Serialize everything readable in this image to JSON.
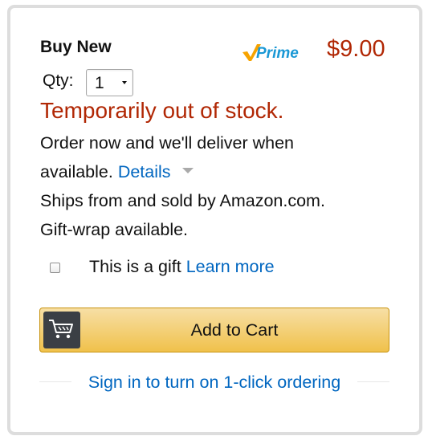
{
  "offer": {
    "heading": "Buy New",
    "prime_logo_text": "Prime",
    "price": "$9.00"
  },
  "quantity": {
    "label": "Qty:",
    "selected": "1"
  },
  "availability": {
    "status": "Temporarily out of stock.",
    "line1": "Order now and we'll deliver when",
    "line2_prefix": "available.",
    "details_link": "Details",
    "ships_from": "Ships from and sold by Amazon.com.",
    "gift_wrap": "Gift-wrap available."
  },
  "gift": {
    "checked": false,
    "label": "This is a gift",
    "learn_more_link": "Learn more"
  },
  "cart_button": {
    "icon": "shopping-cart-icon",
    "label": "Add to Cart"
  },
  "signin": {
    "link": "Sign in to turn on 1-click ordering"
  },
  "colors": {
    "price": "#b12704",
    "link": "#0066c0",
    "button_top": "#f7dfa5",
    "button_bottom": "#f0c14b",
    "prime_check": "#f7a300",
    "prime_text": "#1a98d5"
  }
}
